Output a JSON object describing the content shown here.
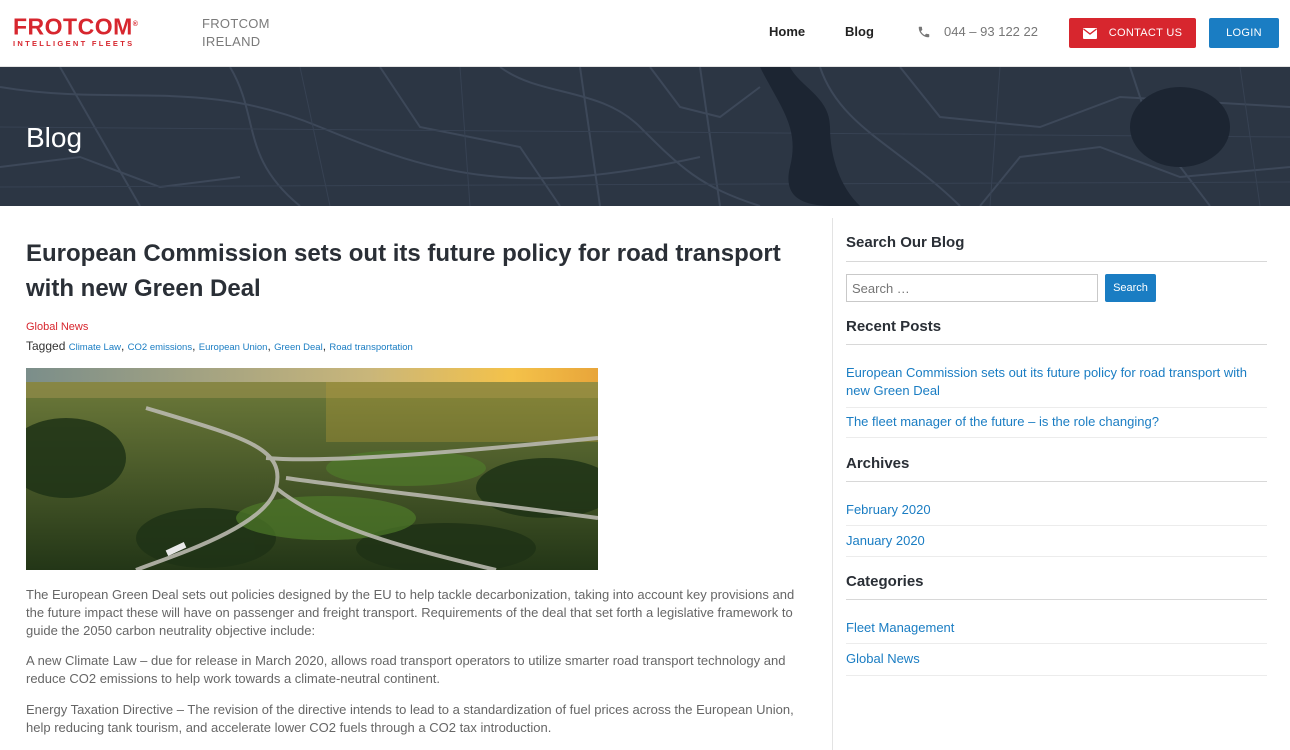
{
  "brand": {
    "logo_word": "FROTCOM",
    "logo_mark": "®",
    "logo_tagline": "INTELLIGENT FLEETS",
    "country_line1": "FROTCOM",
    "country_line2": "IRELAND",
    "brand_red": "#d7262e",
    "brand_blue": "#1a7dc3"
  },
  "nav": {
    "home": "Home",
    "blog": "Blog",
    "phone": "044 – 93 122 22",
    "phone_icon": "phone-icon",
    "contact": "CONTACT US",
    "contact_icon": "envelope-icon",
    "login": "LOGIN"
  },
  "hero": {
    "title": "Blog"
  },
  "post": {
    "title": "European Commission sets out its future policy for road transport with new Green Deal",
    "category": "Global News",
    "tagged_label": "Tagged",
    "tags": [
      "Climate Law",
      "CO2 emissions",
      "European Union",
      "Green Deal",
      "Road transportation"
    ],
    "paragraphs": [
      "The European Green Deal sets out policies designed by the EU to help tackle decarbonization, taking into account key provisions and the future impact these will have on passenger and freight transport. Requirements of the deal that set forth a legislative framework to guide the 2050 carbon neutrality objective include:",
      "A new Climate Law – due for release in March 2020, allows road transport operators to utilize smarter road transport technology and reduce CO2 emissions to help work towards a climate-neutral continent.",
      "Energy Taxation Directive – The revision of the directive intends to lead to a standardization of fuel prices across the European Union, help reducing tank tourism, and accelerate lower CO2 fuels through a CO2 tax introduction."
    ]
  },
  "sidebar": {
    "search_heading": "Search Our Blog",
    "search_placeholder": "Search …",
    "search_button": "Search",
    "recent_heading": "Recent Posts",
    "recent": [
      "European Commission sets out its future policy for road transport with new Green Deal",
      "The fleet manager of the future – is the role changing?"
    ],
    "archives_heading": "Archives",
    "archives": [
      "February 2020",
      "January 2020"
    ],
    "categories_heading": "Categories",
    "categories": [
      "Fleet Management",
      "Global News"
    ]
  }
}
